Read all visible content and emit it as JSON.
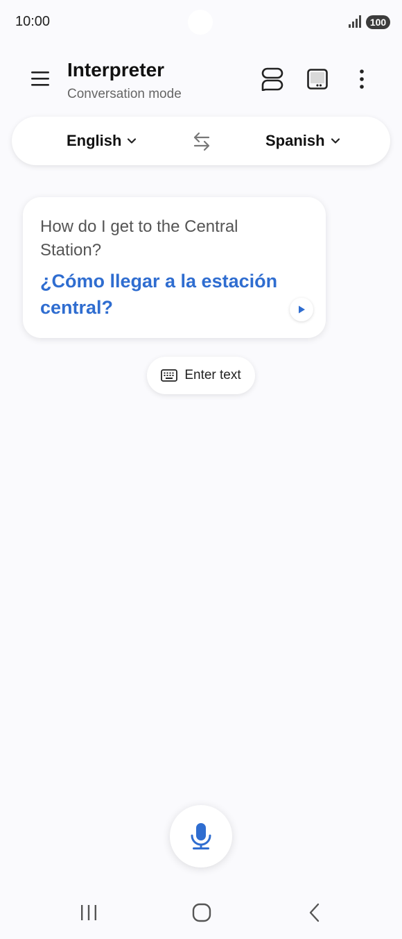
{
  "status_bar": {
    "time": "10:00",
    "battery": "100",
    "icons": [
      "signal-icon",
      "battery-icon"
    ]
  },
  "header": {
    "title": "Interpreter",
    "subtitle": "Conversation mode",
    "icons": [
      "menu-icon",
      "conversation-view-icon",
      "face-to-face-icon",
      "more-options-icon"
    ]
  },
  "languages": {
    "source": "English",
    "target": "Spanish",
    "icons": [
      "chevron-down-icon",
      "swap-languages-icon"
    ]
  },
  "conversation": {
    "messages": [
      {
        "source_text": "How do I get to the Central Station?",
        "translated_text": "¿Cómo llegar a la estación central?",
        "icon": "play-icon"
      }
    ]
  },
  "input": {
    "enter_text_label": "Enter text",
    "icons": [
      "keyboard-icon",
      "microphone-icon"
    ]
  },
  "nav": {
    "icons": [
      "recent-apps-icon",
      "home-icon",
      "back-icon"
    ]
  },
  "colors": {
    "accent": "#2f6dd0",
    "background": "#fafafd",
    "card": "#ffffff"
  }
}
